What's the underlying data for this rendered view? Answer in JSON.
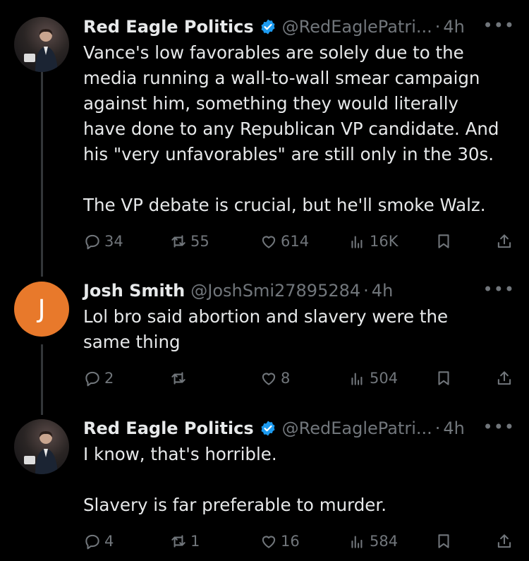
{
  "tweets": [
    {
      "name": "Red Eagle Politics",
      "verified": true,
      "handle": "@RedEaglePatri...",
      "time": "4h",
      "text": "Vance's low favorables are solely due to the\nmedia running a wall-to-wall smear campaign\nagainst him, something they would literally\nhave done to any Republican VP candidate. And\nhis \"very unfavorables\" are still only in the 30s.\n\nThe VP debate is crucial, but he'll smoke Walz.",
      "replies": "34",
      "reposts": "55",
      "likes": "614",
      "views": "16K"
    },
    {
      "name": "Josh Smith",
      "verified": false,
      "avatar_letter": "J",
      "handle": "@JoshSmi27895284",
      "time": "4h",
      "text": "Lol bro said abortion and slavery were the\nsame thing",
      "replies": "2",
      "reposts": "",
      "likes": "8",
      "views": "504"
    },
    {
      "name": "Red Eagle Politics",
      "verified": true,
      "handle": "@RedEaglePatri...",
      "time": "4h",
      "text": "I know, that's horrible.\n\nSlavery is far preferable to murder.",
      "replies": "4",
      "reposts": "1",
      "likes": "16",
      "views": "584"
    }
  ],
  "separator": "·",
  "more_icon": "more-icon",
  "colors": {
    "background": "#000000",
    "text": "#e7e9ea",
    "muted": "#71767b",
    "verified": "#1d9bf0",
    "avatar_orange": "#e8792b"
  }
}
